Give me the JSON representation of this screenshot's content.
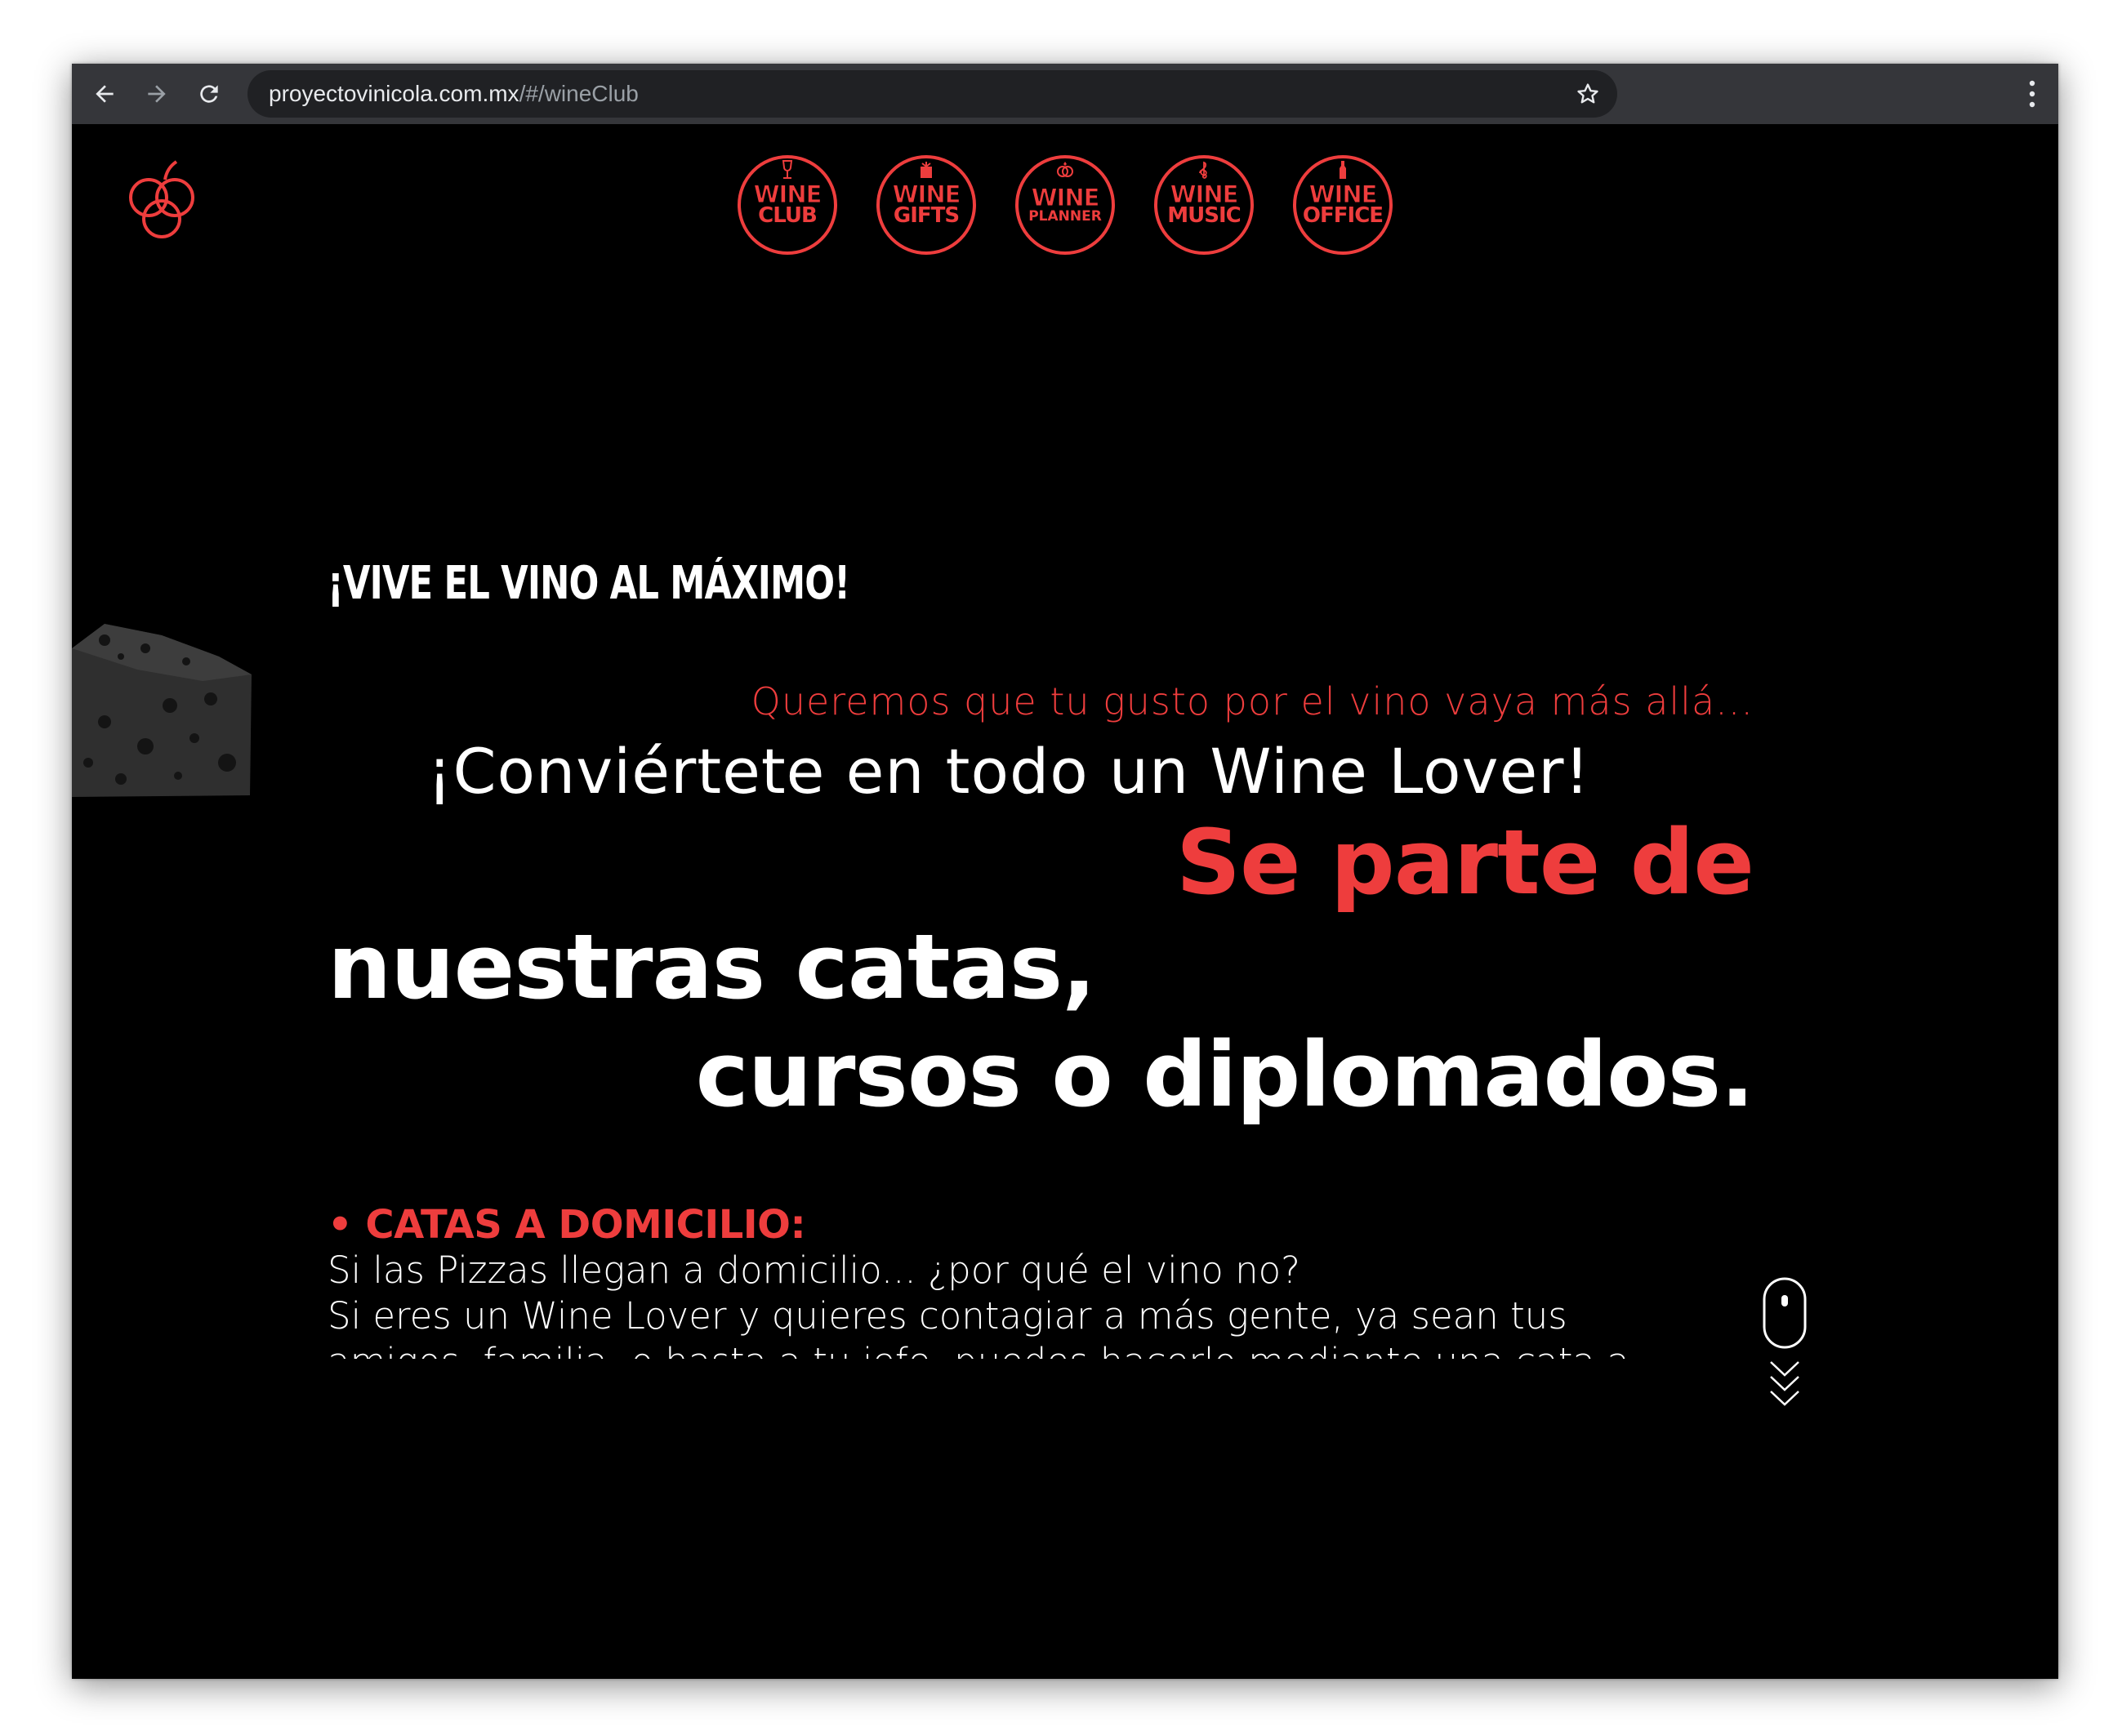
{
  "browser": {
    "url_host": "proyectovinicola.com.mx",
    "url_path": "/#/wineClub"
  },
  "nav": {
    "items": [
      {
        "line1": "WINE",
        "line2": "CLUB",
        "icon": "wine-glass-icon"
      },
      {
        "line1": "WINE",
        "line2": "GIFTS",
        "icon": "gift-icon"
      },
      {
        "line1": "WINE",
        "line2": "PLANNER",
        "icon": "rings-icon"
      },
      {
        "line1": "WINE",
        "line2": "MUSIC",
        "icon": "treble-clef-icon"
      },
      {
        "line1": "WINE",
        "line2": "OFFICE",
        "icon": "bottle-icon"
      }
    ]
  },
  "hero": {
    "headline": "¡VIVE EL VINO AL MÁXIMO!",
    "subtitle_red": "Queremos que tu gusto por el vino vaya más allá...",
    "subtitle_white": "¡Conviértete en todo un Wine Lover!",
    "big_red": "Se parte de",
    "big_white_1": "nuestras catas,",
    "big_white_2": "cursos o diplomados."
  },
  "section": {
    "title": "• CATAS A DOMICILIO:",
    "line1": "Si las Pizzas llegan a domicilio... ¿por qué el vino no?",
    "line2": "Si eres un Wine Lover y quieres contagiar a más gente, ya sean tus",
    "line3": "amigos, familia, o hasta a tu jefe, puedes hacerlo mediante una cata a"
  },
  "colors": {
    "accent": "#ee3d3d",
    "background": "#000000",
    "chrome": "#35363a"
  }
}
